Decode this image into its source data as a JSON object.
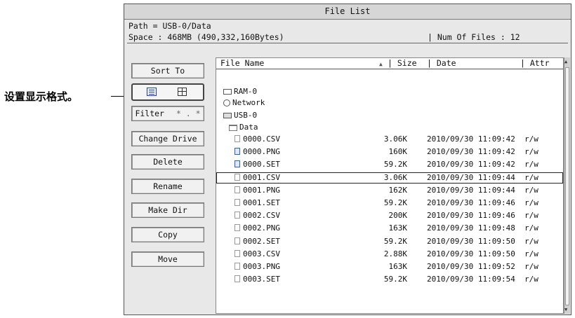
{
  "annotation": {
    "text": "设置显示格式。"
  },
  "window": {
    "title": "File List"
  },
  "info": {
    "path": "Path = USB-0/Data",
    "space": "Space : 468MB (490,332,160Bytes)",
    "num_files": "| Num Of Files : 12"
  },
  "side_buttons": {
    "sort": "Sort To",
    "filter": "Filter",
    "filter_symbol": "* . *",
    "change_drive": "Change Drive",
    "delete": "Delete",
    "rename": "Rename",
    "make_dir": "Make Dir",
    "copy": "Copy",
    "move": "Move"
  },
  "view_toggle": {
    "selected": "list",
    "icons": [
      "list-view-icon",
      "grid-view-icon"
    ]
  },
  "columns": {
    "name": "File Name",
    "size": "| Size",
    "date": "| Date",
    "attr": "| Attr"
  },
  "tree": {
    "drives": [
      {
        "label": "RAM-0",
        "icon": "drive-icon"
      },
      {
        "label": "Network",
        "icon": "network-icon"
      },
      {
        "label": "USB-0",
        "icon": "usb-drive-icon"
      }
    ],
    "folder": "Data"
  },
  "files": [
    {
      "name": "0000.CSV",
      "size": "3.06K",
      "date": "2010/09/30 11:09:42",
      "attr": "r/w",
      "type": "csv"
    },
    {
      "name": "0000.PNG",
      "size": "160K",
      "date": "2010/09/30 11:09:42",
      "attr": "r/w",
      "type": "png"
    },
    {
      "name": "0000.SET",
      "size": "59.2K",
      "date": "2010/09/30 11:09:42",
      "attr": "r/w",
      "type": "png"
    },
    {
      "name": "0001.CSV",
      "size": "3.06K",
      "date": "2010/09/30 11:09:44",
      "attr": "r/w",
      "type": "csv",
      "selected": true
    },
    {
      "name": "0001.PNG",
      "size": "162K",
      "date": "2010/09/30 11:09:44",
      "attr": "r/w",
      "type": "csv"
    },
    {
      "name": "0001.SET",
      "size": "59.2K",
      "date": "2010/09/30 11:09:46",
      "attr": "r/w",
      "type": "csv"
    },
    {
      "name": "0002.CSV",
      "size": "200K",
      "date": "2010/09/30 11:09:46",
      "attr": "r/w",
      "type": "csv"
    },
    {
      "name": "0002.PNG",
      "size": "163K",
      "date": "2010/09/30 11:09:48",
      "attr": "r/w",
      "type": "csv"
    },
    {
      "name": "0002.SET",
      "size": "59.2K",
      "date": "2010/09/30 11:09:50",
      "attr": "r/w",
      "type": "csv"
    },
    {
      "name": "0003.CSV",
      "size": "2.88K",
      "date": "2010/09/30 11:09:50",
      "attr": "r/w",
      "type": "csv"
    },
    {
      "name": "0003.PNG",
      "size": "163K",
      "date": "2010/09/30 11:09:52",
      "attr": "r/w",
      "type": "csv"
    },
    {
      "name": "0003.SET",
      "size": "59.2K",
      "date": "2010/09/30 11:09:54",
      "attr": "r/w",
      "type": "csv"
    }
  ]
}
